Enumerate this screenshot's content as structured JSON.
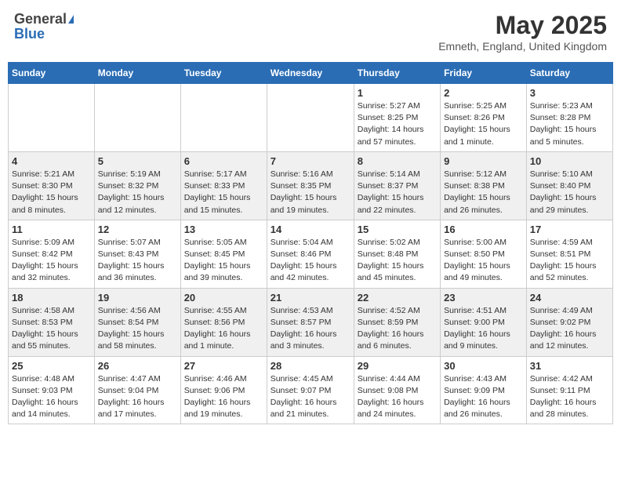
{
  "header": {
    "logo_general": "General",
    "logo_blue": "Blue",
    "title": "May 2025",
    "location": "Emneth, England, United Kingdom"
  },
  "days_of_week": [
    "Sunday",
    "Monday",
    "Tuesday",
    "Wednesday",
    "Thursday",
    "Friday",
    "Saturday"
  ],
  "weeks": [
    [
      {
        "day": "",
        "info": ""
      },
      {
        "day": "",
        "info": ""
      },
      {
        "day": "",
        "info": ""
      },
      {
        "day": "",
        "info": ""
      },
      {
        "day": "1",
        "info": "Sunrise: 5:27 AM\nSunset: 8:25 PM\nDaylight: 14 hours\nand 57 minutes."
      },
      {
        "day": "2",
        "info": "Sunrise: 5:25 AM\nSunset: 8:26 PM\nDaylight: 15 hours\nand 1 minute."
      },
      {
        "day": "3",
        "info": "Sunrise: 5:23 AM\nSunset: 8:28 PM\nDaylight: 15 hours\nand 5 minutes."
      }
    ],
    [
      {
        "day": "4",
        "info": "Sunrise: 5:21 AM\nSunset: 8:30 PM\nDaylight: 15 hours\nand 8 minutes."
      },
      {
        "day": "5",
        "info": "Sunrise: 5:19 AM\nSunset: 8:32 PM\nDaylight: 15 hours\nand 12 minutes."
      },
      {
        "day": "6",
        "info": "Sunrise: 5:17 AM\nSunset: 8:33 PM\nDaylight: 15 hours\nand 15 minutes."
      },
      {
        "day": "7",
        "info": "Sunrise: 5:16 AM\nSunset: 8:35 PM\nDaylight: 15 hours\nand 19 minutes."
      },
      {
        "day": "8",
        "info": "Sunrise: 5:14 AM\nSunset: 8:37 PM\nDaylight: 15 hours\nand 22 minutes."
      },
      {
        "day": "9",
        "info": "Sunrise: 5:12 AM\nSunset: 8:38 PM\nDaylight: 15 hours\nand 26 minutes."
      },
      {
        "day": "10",
        "info": "Sunrise: 5:10 AM\nSunset: 8:40 PM\nDaylight: 15 hours\nand 29 minutes."
      }
    ],
    [
      {
        "day": "11",
        "info": "Sunrise: 5:09 AM\nSunset: 8:42 PM\nDaylight: 15 hours\nand 32 minutes."
      },
      {
        "day": "12",
        "info": "Sunrise: 5:07 AM\nSunset: 8:43 PM\nDaylight: 15 hours\nand 36 minutes."
      },
      {
        "day": "13",
        "info": "Sunrise: 5:05 AM\nSunset: 8:45 PM\nDaylight: 15 hours\nand 39 minutes."
      },
      {
        "day": "14",
        "info": "Sunrise: 5:04 AM\nSunset: 8:46 PM\nDaylight: 15 hours\nand 42 minutes."
      },
      {
        "day": "15",
        "info": "Sunrise: 5:02 AM\nSunset: 8:48 PM\nDaylight: 15 hours\nand 45 minutes."
      },
      {
        "day": "16",
        "info": "Sunrise: 5:00 AM\nSunset: 8:50 PM\nDaylight: 15 hours\nand 49 minutes."
      },
      {
        "day": "17",
        "info": "Sunrise: 4:59 AM\nSunset: 8:51 PM\nDaylight: 15 hours\nand 52 minutes."
      }
    ],
    [
      {
        "day": "18",
        "info": "Sunrise: 4:58 AM\nSunset: 8:53 PM\nDaylight: 15 hours\nand 55 minutes."
      },
      {
        "day": "19",
        "info": "Sunrise: 4:56 AM\nSunset: 8:54 PM\nDaylight: 15 hours\nand 58 minutes."
      },
      {
        "day": "20",
        "info": "Sunrise: 4:55 AM\nSunset: 8:56 PM\nDaylight: 16 hours\nand 1 minute."
      },
      {
        "day": "21",
        "info": "Sunrise: 4:53 AM\nSunset: 8:57 PM\nDaylight: 16 hours\nand 3 minutes."
      },
      {
        "day": "22",
        "info": "Sunrise: 4:52 AM\nSunset: 8:59 PM\nDaylight: 16 hours\nand 6 minutes."
      },
      {
        "day": "23",
        "info": "Sunrise: 4:51 AM\nSunset: 9:00 PM\nDaylight: 16 hours\nand 9 minutes."
      },
      {
        "day": "24",
        "info": "Sunrise: 4:49 AM\nSunset: 9:02 PM\nDaylight: 16 hours\nand 12 minutes."
      }
    ],
    [
      {
        "day": "25",
        "info": "Sunrise: 4:48 AM\nSunset: 9:03 PM\nDaylight: 16 hours\nand 14 minutes."
      },
      {
        "day": "26",
        "info": "Sunrise: 4:47 AM\nSunset: 9:04 PM\nDaylight: 16 hours\nand 17 minutes."
      },
      {
        "day": "27",
        "info": "Sunrise: 4:46 AM\nSunset: 9:06 PM\nDaylight: 16 hours\nand 19 minutes."
      },
      {
        "day": "28",
        "info": "Sunrise: 4:45 AM\nSunset: 9:07 PM\nDaylight: 16 hours\nand 21 minutes."
      },
      {
        "day": "29",
        "info": "Sunrise: 4:44 AM\nSunset: 9:08 PM\nDaylight: 16 hours\nand 24 minutes."
      },
      {
        "day": "30",
        "info": "Sunrise: 4:43 AM\nSunset: 9:09 PM\nDaylight: 16 hours\nand 26 minutes."
      },
      {
        "day": "31",
        "info": "Sunrise: 4:42 AM\nSunset: 9:11 PM\nDaylight: 16 hours\nand 28 minutes."
      }
    ]
  ]
}
